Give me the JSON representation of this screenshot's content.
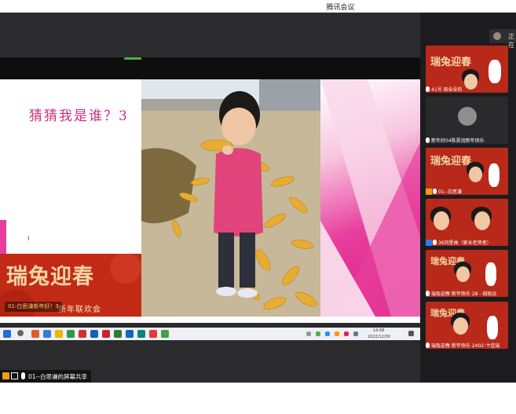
{
  "window": {
    "title": "腾讯会议"
  },
  "slide": {
    "title": "猜猜我是谁？3",
    "banner_title": "瑞兔迎春",
    "banner_sub": "新年联欢会",
    "badge": "01-白思谦新年好！3",
    "cursor": "I"
  },
  "taskbar": {
    "time": "14:58",
    "date": "2022/12/30"
  },
  "share": {
    "label": "01--白思谦的屏幕共享"
  },
  "sidebar": {
    "status_text": "正在",
    "tiles": [
      {
        "name": "41号 周朵朵的",
        "style": "red"
      },
      {
        "name": "新年好04陈昊润新年快乐",
        "style": "dark"
      },
      {
        "name": "01--白思谦",
        "style": "red"
      },
      {
        "name": "36刘星曲（家长老师者）",
        "style": "red"
      },
      {
        "name": "瑞兔迎春 新年快乐 28 - 田致远",
        "style": "red"
      },
      {
        "name": "瑞兔迎春 新年快乐 2402-卞佳瑞",
        "style": "red"
      }
    ],
    "tile_banner": "瑞兔迎春"
  },
  "colors": {
    "accent_pink": "#cc2f7f",
    "banner_red": "#c22a16",
    "gold": "#f2d5a3"
  },
  "icons": [
    "windows-start-icon",
    "search-icon",
    "mic-icon",
    "camera-icon",
    "avatar-icon"
  ]
}
